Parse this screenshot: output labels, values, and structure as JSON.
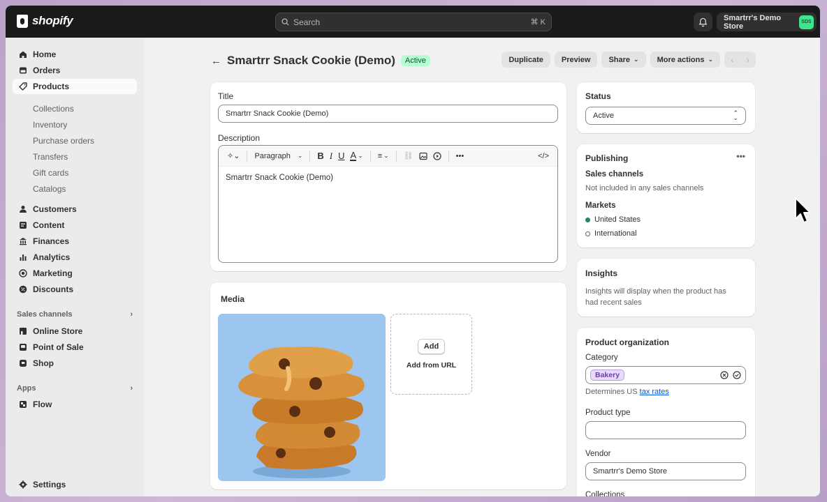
{
  "topbar": {
    "logo_text": "shopify",
    "search_placeholder": "Search",
    "search_shortcut": "⌘ K",
    "store_name": "Smartrr's Demo Store",
    "store_initials": "SDS"
  },
  "sidebar": {
    "items": [
      {
        "label": "Home",
        "icon": "home-icon"
      },
      {
        "label": "Orders",
        "icon": "orders-icon"
      },
      {
        "label": "Products",
        "icon": "tag-icon"
      }
    ],
    "product_subitems": [
      "Collections",
      "Inventory",
      "Purchase orders",
      "Transfers",
      "Gift cards",
      "Catalogs"
    ],
    "items2": [
      {
        "label": "Customers",
        "icon": "person-icon"
      },
      {
        "label": "Content",
        "icon": "content-icon"
      },
      {
        "label": "Finances",
        "icon": "bank-icon"
      },
      {
        "label": "Analytics",
        "icon": "chart-icon"
      },
      {
        "label": "Marketing",
        "icon": "target-icon"
      },
      {
        "label": "Discounts",
        "icon": "discount-icon"
      }
    ],
    "sales_channels_label": "Sales channels",
    "channels": [
      {
        "label": "Online Store",
        "icon": "store-icon"
      },
      {
        "label": "Point of Sale",
        "icon": "pos-icon"
      },
      {
        "label": "Shop",
        "icon": "shop-icon"
      }
    ],
    "apps_label": "Apps",
    "apps": [
      {
        "label": "Flow",
        "icon": "flow-icon"
      }
    ],
    "settings_label": "Settings"
  },
  "header": {
    "title": "Smartrr Snack Cookie (Demo)",
    "status_badge": "Active",
    "actions": [
      "Duplicate",
      "Preview",
      "Share",
      "More actions"
    ]
  },
  "main": {
    "title_label": "Title",
    "title_value": "Smartrr Snack Cookie (Demo)",
    "description_label": "Description",
    "paragraph_label": "Paragraph",
    "description_value": "Smartrr Snack Cookie (Demo)",
    "media_label": "Media",
    "add_button": "Add",
    "add_from_url": "Add from URL"
  },
  "right": {
    "status_label": "Status",
    "status_value": "Active",
    "publishing_label": "Publishing",
    "sales_channels_label": "Sales channels",
    "sales_channels_value": "Not included in any sales channels",
    "markets_label": "Markets",
    "markets": [
      {
        "name": "United States",
        "active": true
      },
      {
        "name": "International",
        "active": false
      }
    ],
    "insights_label": "Insights",
    "insights_text_1": "Insights will display when the product has",
    "insights_text_2": "had recent sales",
    "org_label": "Product organization",
    "category_label": "Category",
    "category_value": "Bakery",
    "determines_text": "Determines US",
    "tax_link": "tax rates",
    "product_type_label": "Product type",
    "product_type_value": "",
    "vendor_label": "Vendor",
    "vendor_value": "Smartrr's Demo Store",
    "collections_label": "Collections"
  },
  "colors": {
    "topbar": "#1a1a1a",
    "sidebar": "#ebebeb",
    "active_badge": "#b4fed2",
    "market_active": "#29845a",
    "category_tag": "#e8daff",
    "link": "#005bd3"
  }
}
